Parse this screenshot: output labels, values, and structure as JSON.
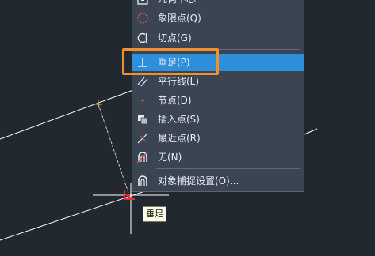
{
  "snap_menu": {
    "items": [
      {
        "label": "几何中心",
        "icon": "geometric-center-icon"
      },
      {
        "label": "象限点(Q)",
        "icon": "quadrant-icon"
      },
      {
        "label": "切点(G)",
        "icon": "tangent-icon"
      },
      {
        "label": "垂足(P)",
        "icon": "perpendicular-icon",
        "highlighted": true
      },
      {
        "label": "平行线(L)",
        "icon": "parallel-icon"
      },
      {
        "label": "节点(D)",
        "icon": "node-icon"
      },
      {
        "label": "插入点(S)",
        "icon": "insertion-icon"
      },
      {
        "label": "最近点(R)",
        "icon": "nearest-icon"
      },
      {
        "label": "无(N)",
        "icon": "none-icon"
      },
      {
        "label": "对象捕捉设置(O)...",
        "icon": "osnap-settings-icon"
      }
    ]
  },
  "tooltip": {
    "text": "垂足"
  },
  "colors": {
    "canvas_background": "#212830",
    "menu_background": "#3b4453",
    "highlight": "#2e8fdb",
    "callout_border": "#f2902e",
    "snap_marker": "#e03030",
    "tooltip_background": "#fdfde6"
  }
}
